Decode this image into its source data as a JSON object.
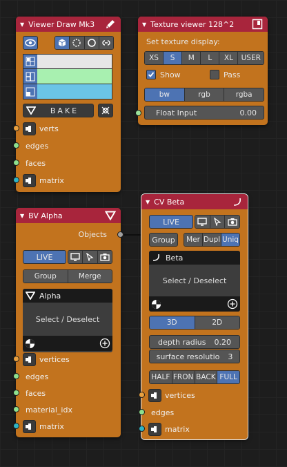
{
  "node1": {
    "title": "Viewer Draw Mk3",
    "bake_label": "BAKE",
    "color_swatches": [
      "#e6e6e6",
      "#a8f0b0",
      "#6bc4e6"
    ],
    "sockets": [
      {
        "label": "verts",
        "type": "vertices"
      },
      {
        "label": "edges",
        "type": "edges"
      },
      {
        "label": "faces",
        "type": "faces"
      },
      {
        "label": "matrix",
        "type": "matrix"
      }
    ]
  },
  "node2": {
    "title": "Texture viewer 128^2",
    "set_label": "Set texture display:",
    "size_options": [
      "XS",
      "S",
      "M",
      "L",
      "XL",
      "USER"
    ],
    "size_selected": "S",
    "show_label": "Show",
    "show_checked": true,
    "pass_label": "Pass",
    "pass_checked": false,
    "mode_options": [
      "bw",
      "rgb",
      "rgba"
    ],
    "mode_selected": "bw",
    "float_label": "Float Input",
    "float_value": "0.00"
  },
  "node3": {
    "title": "BV Alpha",
    "output_label": "Objects",
    "live_label": "LIVE",
    "group_label": "Group",
    "merge_label": "Merge",
    "selector_name": "Alpha",
    "select_label": "Select / Deselect",
    "sockets": [
      {
        "label": "vertices"
      },
      {
        "label": "edges"
      },
      {
        "label": "faces"
      },
      {
        "label": "material_idx"
      },
      {
        "label": "matrix"
      }
    ]
  },
  "node4": {
    "title": "CV Beta",
    "live_label": "LIVE",
    "group_label": "Group",
    "mode_options": [
      "Mer",
      "Dupl",
      "Uniq"
    ],
    "mode_selected": "Uniq",
    "selector_name": "Beta",
    "select_label": "Select / Deselect",
    "dim_options": [
      "3D",
      "2D"
    ],
    "dim_selected": "3D",
    "depth_label": "depth radius",
    "depth_value": "0.20",
    "surface_label": "surface resolutio",
    "surface_value": "3",
    "view_options": [
      "HALF",
      "FRON",
      "BACK",
      "FULL"
    ],
    "view_selected": "FULL",
    "sockets": [
      {
        "label": "vertices"
      },
      {
        "label": "edges"
      },
      {
        "label": "matrix"
      }
    ]
  },
  "colors": {
    "node_body": "#c2731e",
    "node_header": "#a8253c",
    "accent": "#4d73b3",
    "vertex_socket": "#e8a040",
    "edge_socket": "#8ee08e",
    "matrix_socket": "#2fb4c4"
  }
}
